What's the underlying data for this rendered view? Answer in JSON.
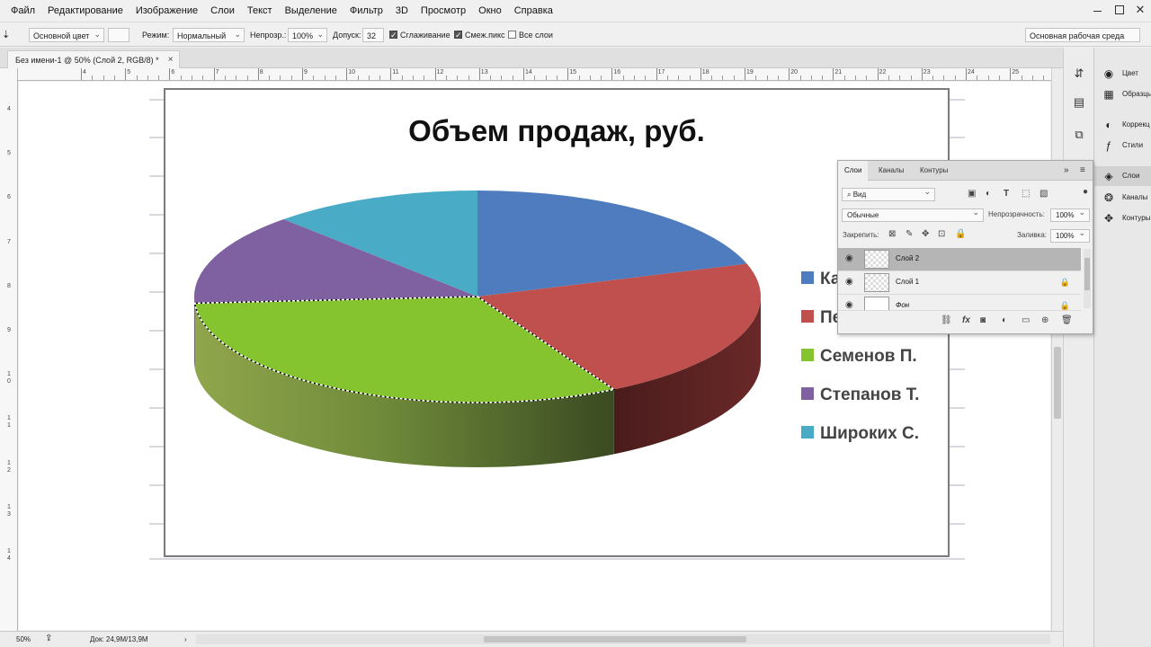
{
  "menu": [
    "Файл",
    "Редактирование",
    "Изображение",
    "Слои",
    "Текст",
    "Выделение",
    "Фильтр",
    "3D",
    "Просмотр",
    "Окно",
    "Справка"
  ],
  "options": {
    "sample": "Основной цвет",
    "mode_label": "Режим:",
    "mode_value": "Нормальный",
    "opacity_label": "Непрозр.:",
    "opacity_value": "100%",
    "tolerance_label": "Допуск:",
    "tolerance_value": "32",
    "antialias_label": "Сглаживание",
    "contiguous_label": "Смеж.пикс",
    "all_layers_label": "Все слои",
    "workspace": "Основная рабочая среда"
  },
  "document": {
    "tab_title": "Без имени-1 @ 50% (Слой 2, RGB/8) *",
    "close": "×"
  },
  "rulers": {
    "h": [
      "4",
      "5",
      "6",
      "7",
      "8",
      "9",
      "10",
      "11",
      "12",
      "13",
      "14",
      "15",
      "16",
      "17",
      "18",
      "19",
      "20",
      "21",
      "22",
      "23",
      "24",
      "25"
    ],
    "v": [
      "4",
      "5",
      "6",
      "7",
      "8",
      "9",
      "10",
      "11",
      "12",
      "13",
      "14"
    ]
  },
  "chart_data": {
    "type": "pie",
    "title": "Объем продаж, руб.",
    "categories": [
      "Каменев",
      "Петров",
      "Семенов П.",
      "Степанов Т.",
      "Широких С."
    ],
    "legend_visible": [
      "Ка",
      "Пе",
      "Семенов П.",
      "Степанов Т.",
      "Широких С."
    ],
    "values": [
      20,
      22,
      32,
      14,
      12
    ],
    "colors": [
      "#4e7cbf",
      "#c0504d",
      "#86c42f",
      "#7f60a0",
      "#4aabc6"
    ],
    "legend_position": "right",
    "style": "3d-exploded-selection"
  },
  "layers_panel": {
    "tabs": [
      "Слои",
      "Каналы",
      "Контуры"
    ],
    "filter": "Вид",
    "blend_mode": "Обычные",
    "opacity_label": "Непрозрачность:",
    "opacity_value": "100%",
    "lock_label": "Закрепить:",
    "fill_label": "Заливка:",
    "fill_value": "100%",
    "layers": [
      {
        "name": "Слой 2",
        "selected": true,
        "locked": false
      },
      {
        "name": "Слой 1",
        "selected": false,
        "locked": true
      },
      {
        "name": "Фон",
        "selected": false,
        "locked": true
      }
    ]
  },
  "side_panel": [
    {
      "label": "Цвет",
      "icon": "color-icon"
    },
    {
      "label": "Образцы",
      "icon": "swatches-icon"
    },
    {
      "label": "Коррекц",
      "icon": "adjustments-icon"
    },
    {
      "label": "Стили",
      "icon": "styles-icon"
    },
    {
      "label": "Слои",
      "icon": "layers-icon"
    },
    {
      "label": "Каналы",
      "icon": "channels-icon"
    },
    {
      "label": "Контуры",
      "icon": "paths-icon"
    }
  ],
  "status": {
    "zoom": "50%",
    "doc": "Док: 24,9M/13,9M"
  }
}
